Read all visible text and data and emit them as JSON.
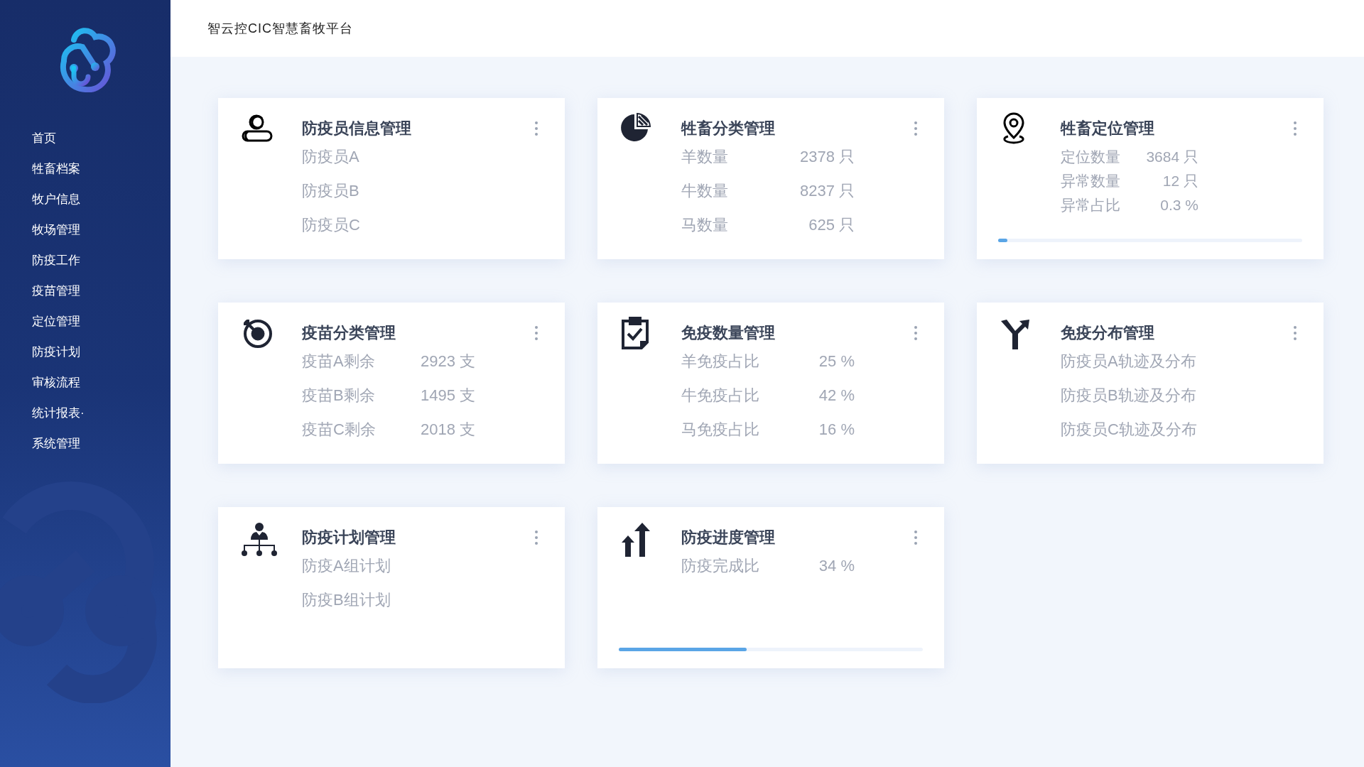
{
  "header": {
    "title": "智云控CIC智慧畜牧平台"
  },
  "sidebar": {
    "items": [
      {
        "label": "首页"
      },
      {
        "label": "牲畜档案"
      },
      {
        "label": "牧户信息"
      },
      {
        "label": "牧场管理"
      },
      {
        "label": "防疫工作"
      },
      {
        "label": "疫苗管理"
      },
      {
        "label": "定位管理"
      },
      {
        "label": "防疫计划"
      },
      {
        "label": "审核流程"
      },
      {
        "label": "统计报表·"
      },
      {
        "label": "系统管理"
      }
    ]
  },
  "cards": [
    {
      "kind": "list",
      "title": "防疫员信息管理",
      "rows": [
        {
          "label": "防疫员A"
        },
        {
          "label": "防疫员B"
        },
        {
          "label": "防疫员C"
        }
      ]
    },
    {
      "kind": "list",
      "title": "牲畜分类管理",
      "rows": [
        {
          "label": "羊数量",
          "value": "2378 只"
        },
        {
          "label": "牛数量",
          "value": "8237 只"
        },
        {
          "label": "马数量",
          "value": "625 只"
        }
      ]
    },
    {
      "kind": "compact",
      "title": "牲畜定位管理",
      "rows": [
        {
          "label": "定位数量",
          "value": "3684 只"
        },
        {
          "label": "异常数量",
          "value": "12 只"
        },
        {
          "label": "异常占比",
          "value": "0.3 %"
        }
      ],
      "level": 0.03
    },
    {
      "kind": "list",
      "title": "疫苗分类管理",
      "rows": [
        {
          "label": "疫苗A剩余",
          "value": "2923 支"
        },
        {
          "label": "疫苗B剩余",
          "value": "1495 支"
        },
        {
          "label": "疫苗C剩余",
          "value": "2018 支"
        }
      ]
    },
    {
      "kind": "list",
      "title": "免疫数量管理",
      "rows": [
        {
          "label": "羊免疫占比",
          "value": "25 %"
        },
        {
          "label": "牛免疫占比",
          "value": "42 %"
        },
        {
          "label": "马免疫占比",
          "value": "16 %"
        }
      ]
    },
    {
      "kind": "list",
      "title": "免疫分布管理",
      "rows": [
        {
          "label": "防疫员A轨迹及分布"
        },
        {
          "label": "防疫员B轨迹及分布"
        },
        {
          "label": "防疫员C轨迹及分布"
        }
      ]
    },
    {
      "kind": "list",
      "title": "防疫计划管理",
      "rows": [
        {
          "label": "防疫A组计划"
        },
        {
          "label": "防疫B组计划"
        }
      ]
    },
    {
      "kind": "progress",
      "title": "防疫进度管理",
      "rows": [
        {
          "label": "防疫完成比",
          "value": "34 %"
        }
      ],
      "level": 0.42
    }
  ]
}
